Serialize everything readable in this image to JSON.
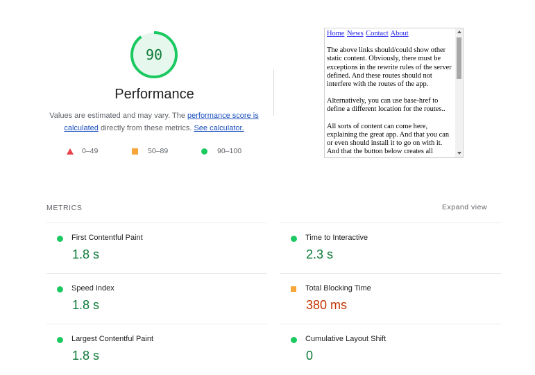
{
  "score": {
    "value": "90",
    "fraction": 0.9,
    "ring_color": "#1cc961",
    "track_color": "#e6f8ed",
    "text_color": "#0c7a37"
  },
  "category": {
    "title": "Performance",
    "desc_prefix": "Values are estimated and may vary. The ",
    "desc_link": "performance score is calculated",
    "desc_middle": " directly from these metrics. ",
    "desc_calc_link": "See calculator."
  },
  "legend": [
    {
      "icon": "triangle-fail-icon",
      "label": "0–49",
      "color": "#e8404a"
    },
    {
      "icon": "square-average-icon",
      "label": "50–89",
      "color": "#f8a53a"
    },
    {
      "icon": "circle-pass-icon",
      "label": "90–100",
      "color": "#1cc961"
    }
  ],
  "preview": {
    "nav": [
      "Home",
      "News",
      "Contact",
      "About"
    ],
    "paragraphs": [
      "The above links should/could show other static content. Obviously, there must be exceptions in the rewrite rules of the server defined. And these routes should not interfere with the routes of the app.",
      "Alternatively, you can use base-href to define a different location for the routes..",
      "All sorts of content can come here, explaining the great app. And that you can or even should install it to go on with it. And that the button below creates all"
    ]
  },
  "metrics": {
    "header": "METRICS",
    "expand_label": "Expand view",
    "items": [
      {
        "name": "First Contentful Paint",
        "value": "1.8 s",
        "rating": "pass"
      },
      {
        "name": "Time to Interactive",
        "value": "2.3 s",
        "rating": "pass"
      },
      {
        "name": "Speed Index",
        "value": "1.8 s",
        "rating": "pass"
      },
      {
        "name": "Total Blocking Time",
        "value": "380 ms",
        "rating": "average"
      },
      {
        "name": "Largest Contentful Paint",
        "value": "1.8 s",
        "rating": "pass"
      },
      {
        "name": "Cumulative Layout Shift",
        "value": "0",
        "rating": "pass"
      }
    ]
  }
}
